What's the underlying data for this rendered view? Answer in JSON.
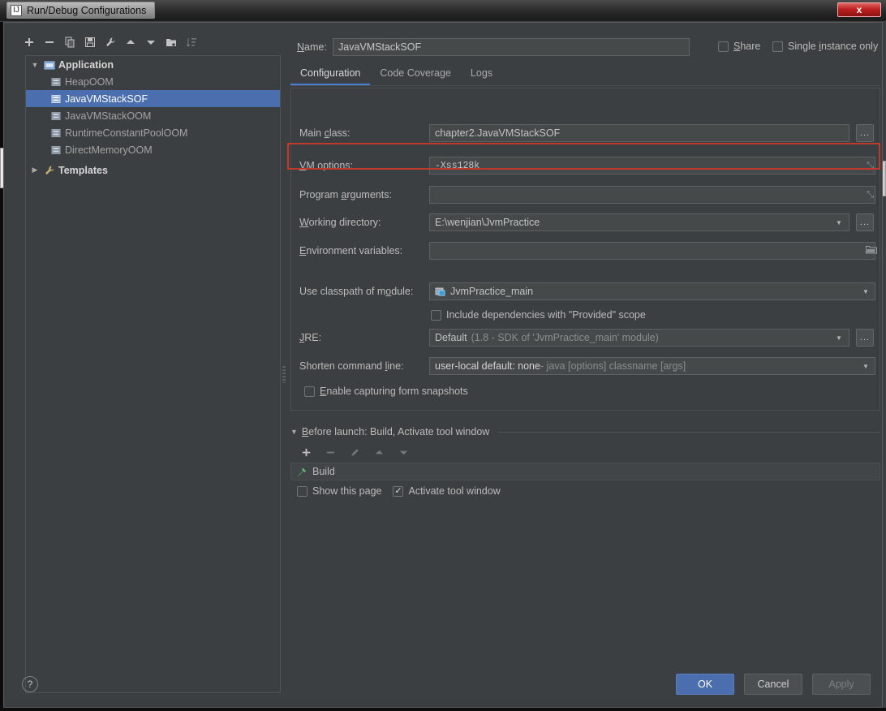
{
  "window": {
    "title": "Run/Debug Configurations",
    "app_icon": "idea-logo-icon",
    "close_label": "x"
  },
  "toolbar": {
    "buttons": [
      {
        "name": "add-configuration-button",
        "icon": "plus-icon",
        "enabled": true
      },
      {
        "name": "remove-configuration-button",
        "icon": "minus-icon",
        "enabled": true
      },
      {
        "name": "copy-configuration-button",
        "icon": "copy-icon",
        "enabled": true
      },
      {
        "name": "save-configuration-button",
        "icon": "save-icon",
        "enabled": true
      },
      {
        "name": "edit-templates-button",
        "icon": "wrench-icon",
        "enabled": true
      },
      {
        "name": "move-up-button",
        "icon": "arrow-up-icon",
        "enabled": true
      },
      {
        "name": "move-down-button",
        "icon": "arrow-down-icon",
        "enabled": true
      },
      {
        "name": "move-into-folder-button",
        "icon": "folder-add-icon",
        "enabled": true
      },
      {
        "name": "sort-configurations-button",
        "icon": "sort-icon",
        "enabled": false
      }
    ]
  },
  "tree": {
    "items": [
      {
        "label": "Application",
        "type": "group",
        "expanded": true,
        "icon": "application-icon",
        "selected": false,
        "arrow": "▼"
      },
      {
        "label": "HeapOOM",
        "type": "child",
        "icon": "run-config-icon",
        "selected": false
      },
      {
        "label": "JavaVMStackSOF",
        "type": "child",
        "icon": "run-config-icon",
        "selected": true
      },
      {
        "label": "JavaVMStackOOM",
        "type": "child",
        "icon": "run-config-icon",
        "selected": false
      },
      {
        "label": "RuntimeConstantPoolOOM",
        "type": "child",
        "icon": "run-config-icon",
        "selected": false
      },
      {
        "label": "DirectMemoryOOM",
        "type": "child",
        "icon": "run-config-icon",
        "selected": false
      },
      {
        "label": "Templates",
        "type": "group",
        "expanded": false,
        "icon": "wrench-icon",
        "selected": false,
        "arrow": "▶"
      }
    ]
  },
  "name_row": {
    "label": "Name:",
    "value": "JavaVMStackSOF",
    "placeholder": "",
    "share": {
      "label": "Share",
      "checked": false
    },
    "single_instance": {
      "label": "Single instance only",
      "checked": false
    }
  },
  "tabs": [
    {
      "label": "Configuration",
      "active": true
    },
    {
      "label": "Code Coverage",
      "active": false
    },
    {
      "label": "Logs",
      "active": false
    }
  ],
  "configuration": {
    "main_class": {
      "label": "Main class:",
      "value": "chapter2.JavaVMStackSOF",
      "browse": "..."
    },
    "vm_options": {
      "label": "VM options:",
      "value": "-Xss128k",
      "expand": "⤡",
      "highlighted": true
    },
    "program_arguments": {
      "label": "Program arguments:",
      "value": "",
      "expand": "⤡"
    },
    "working_directory": {
      "label": "Working directory:",
      "value": "E:\\wenjian\\JvmPractice",
      "browse": "...",
      "arrow": "▼"
    },
    "environment_variables": {
      "label": "Environment variables:",
      "value": "",
      "icon": "folder-icon"
    },
    "use_classpath_of_module": {
      "label": "Use classpath of module:",
      "value": "JvmPractice_main",
      "icon": "module-icon",
      "arrow": "▼"
    },
    "include_provided": {
      "label": "Include dependencies with \"Provided\" scope",
      "checked": false
    },
    "jre": {
      "label": "JRE:",
      "value": "Default",
      "hint": "(1.8 - SDK of 'JvmPractice_main' module)",
      "browse": "...",
      "arrow": "▼"
    },
    "shorten_command_line": {
      "label": "Shorten command line:",
      "value_bold": "user-local default: none",
      "value_rest": " - java [options] classname [args]",
      "arrow": "▼"
    },
    "enable_capturing": {
      "label": "Enable capturing form snapshots",
      "checked": false
    }
  },
  "before_launch": {
    "title": "Before launch: Build, Activate tool window",
    "arrow": "▼",
    "toolbar": [
      {
        "name": "add-task-button",
        "icon": "plus-icon",
        "enabled": true
      },
      {
        "name": "remove-task-button",
        "icon": "minus-icon",
        "enabled": false
      },
      {
        "name": "edit-task-button",
        "icon": "pencil-icon",
        "enabled": false
      },
      {
        "name": "task-move-up-button",
        "icon": "arrow-up-icon",
        "enabled": false
      },
      {
        "name": "task-move-down-button",
        "icon": "arrow-down-icon",
        "enabled": false
      }
    ],
    "tasks": [
      {
        "label": "Build",
        "icon": "build-hammer-icon"
      }
    ],
    "show_this_page": {
      "label": "Show this page",
      "checked": false
    },
    "activate_tool_window": {
      "label": "Activate tool window",
      "checked": true
    }
  },
  "footer": {
    "help": "?",
    "ok": "OK",
    "cancel": "Cancel",
    "apply": "Apply"
  },
  "colors": {
    "dialog_bg": "#3c3f41",
    "selection_blue": "#4b6eaf",
    "accent_tab": "#4b7fd6",
    "annotation_red": "#c0392b",
    "field_bg": "#45494a",
    "text": "#bbbbbb"
  }
}
